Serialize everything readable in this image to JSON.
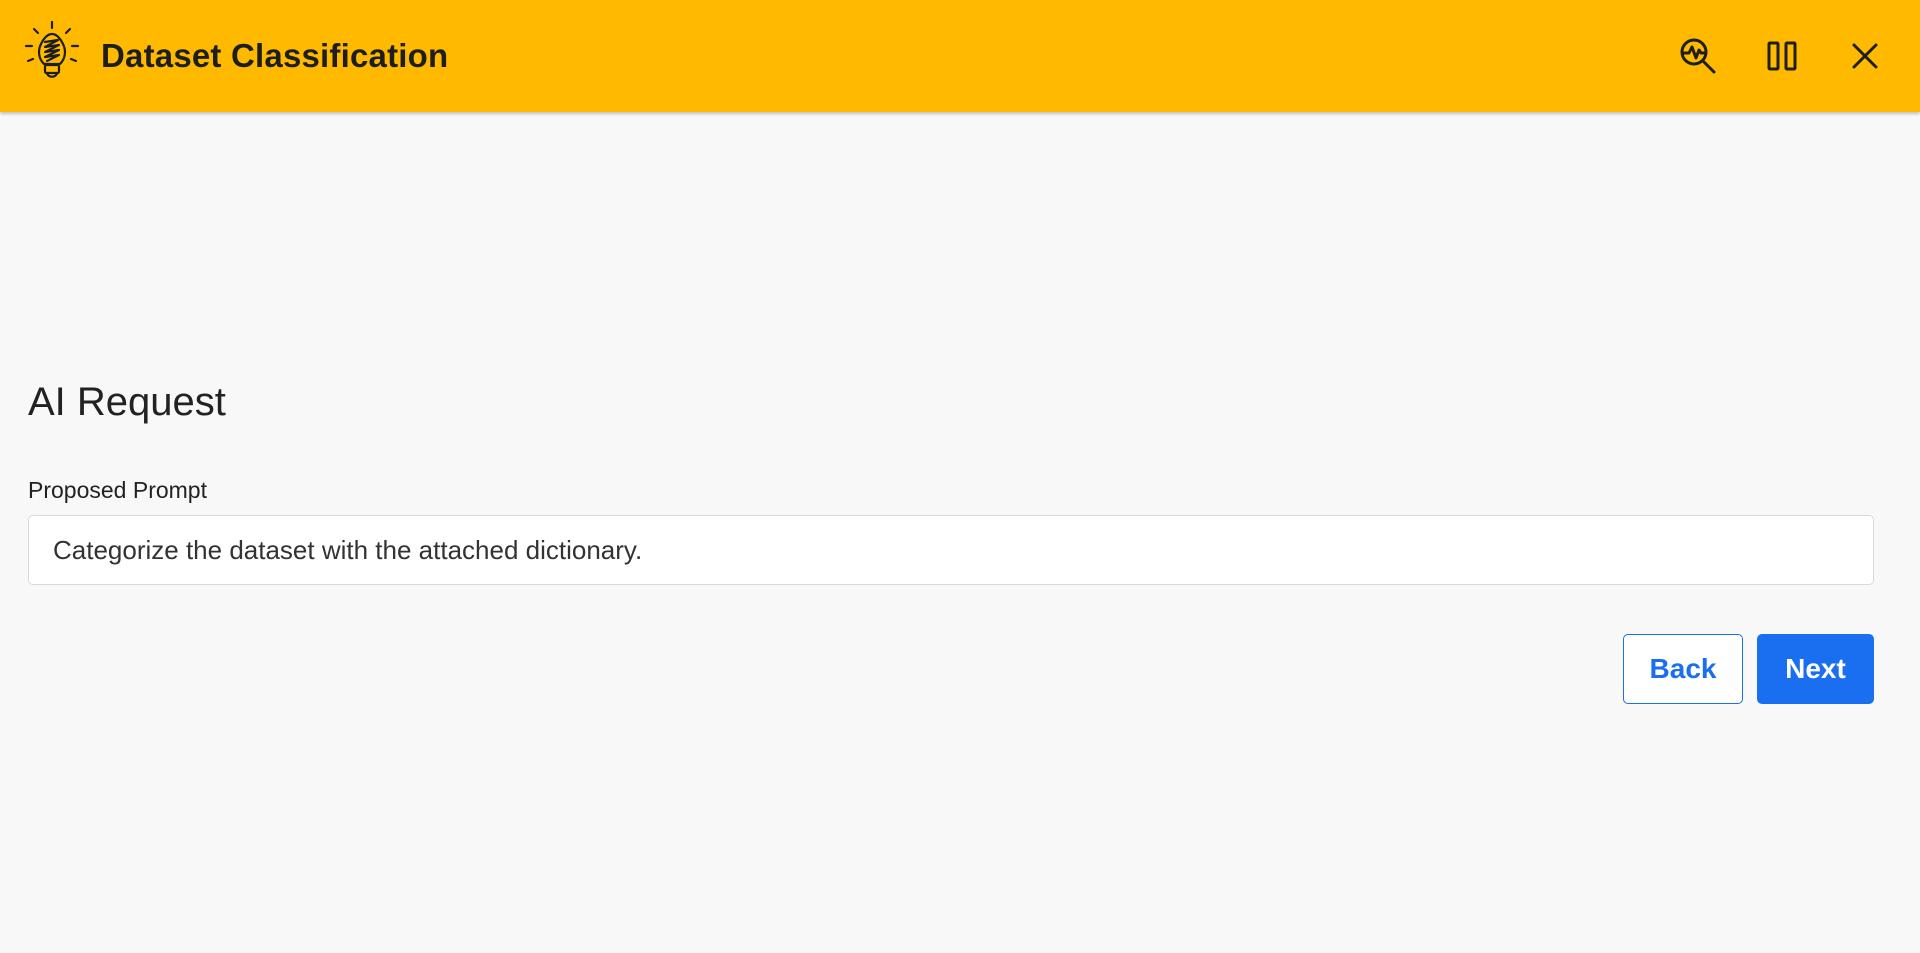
{
  "header": {
    "title": "Dataset Classification",
    "background_color": "#ffba00",
    "logo_icon": "lightbulb-icon",
    "actions": [
      {
        "icon": "inspect-icon"
      },
      {
        "icon": "columns-icon"
      },
      {
        "icon": "close-icon"
      }
    ]
  },
  "main": {
    "section_title": "AI Request",
    "prompt": {
      "label": "Proposed Prompt",
      "value": "Categorize the dataset with the attached dictionary."
    },
    "buttons": {
      "back_label": "Back",
      "next_label": "Next"
    }
  },
  "colors": {
    "accent": "#1a6ef0",
    "page_background": "#f8f8f8"
  }
}
